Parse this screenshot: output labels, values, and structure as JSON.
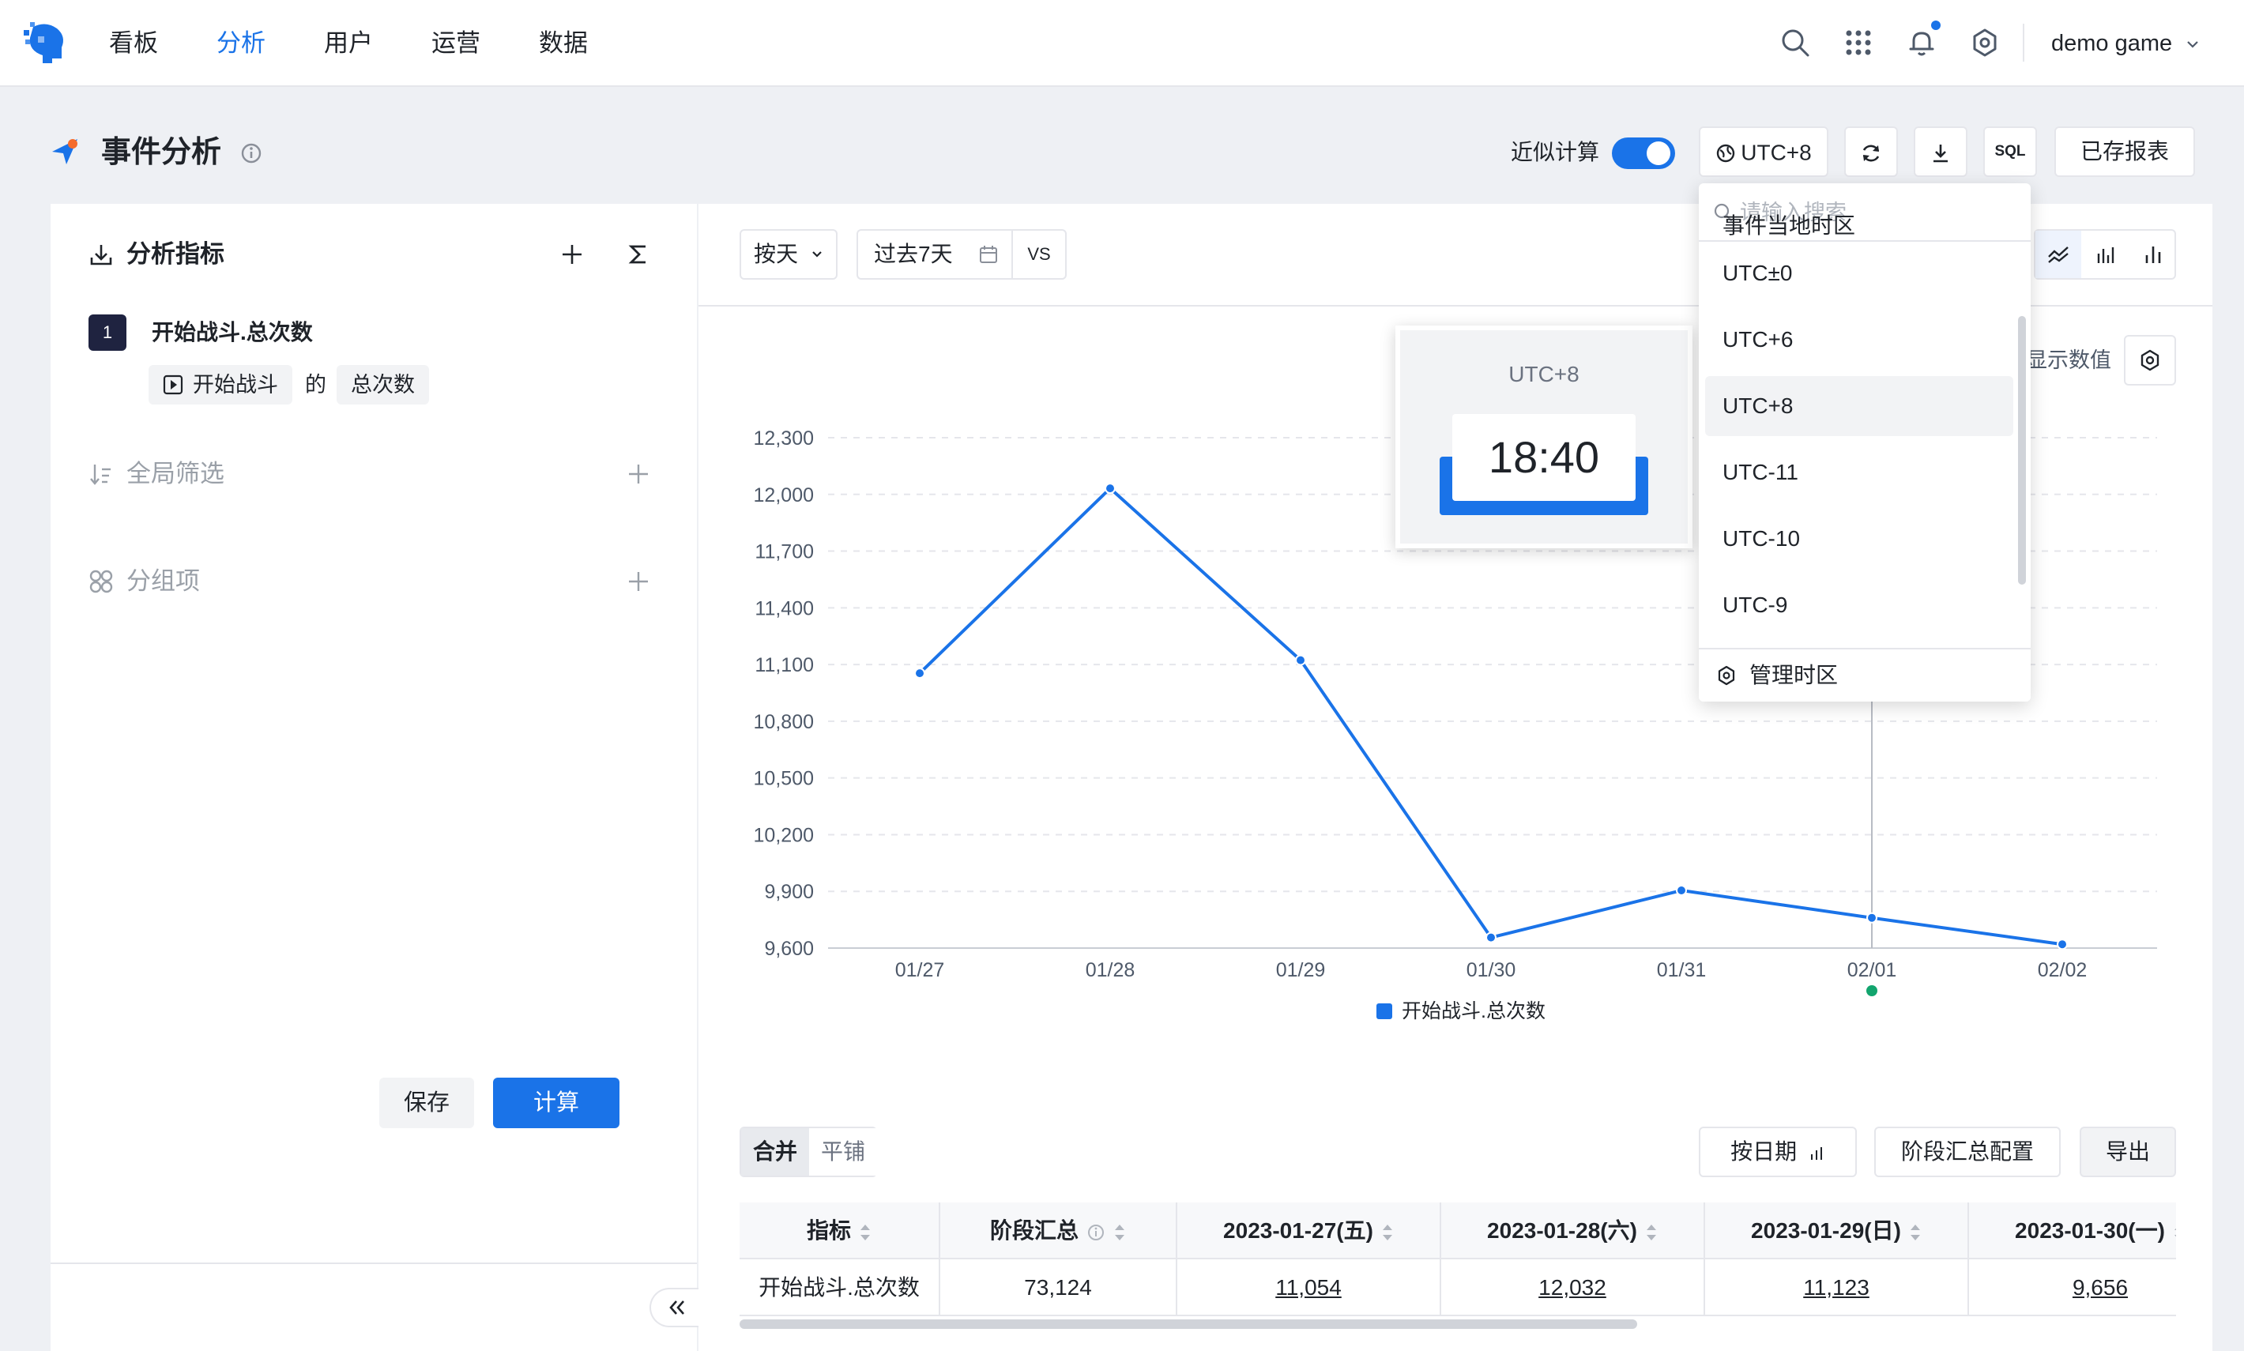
{
  "nav": {
    "items": [
      {
        "label": "看板",
        "active": false
      },
      {
        "label": "分析",
        "active": true
      },
      {
        "label": "用户",
        "active": false
      },
      {
        "label": "运营",
        "active": false
      },
      {
        "label": "数据",
        "active": false
      }
    ],
    "project": "demo game",
    "icons": [
      "search-icon",
      "apps-grid-icon",
      "bell-icon",
      "gear-icon"
    ],
    "accent": "#1a73e8"
  },
  "header": {
    "title": "事件分析",
    "approx_label": "近似计算",
    "approx_on": true,
    "timezone_label": "UTC+8",
    "sql_label": "SQL",
    "saved_reports": "已存报表"
  },
  "left": {
    "metrics_title": "分析指标",
    "metric": {
      "index": "1",
      "name": "开始战斗.总次数",
      "event": "开始战斗",
      "connector": "的",
      "measure": "总次数"
    },
    "filter_title": "全局筛选",
    "group_title": "分组项",
    "save": "保存",
    "compute": "计算"
  },
  "toolbar": {
    "granularity": "按天",
    "date_range": "过去7天",
    "vs": "VS",
    "show_values": "显示数值"
  },
  "chart_data": {
    "type": "line",
    "categories": [
      "01/27",
      "01/28",
      "01/29",
      "01/30",
      "01/31",
      "02/01",
      "02/02"
    ],
    "series": [
      {
        "name": "开始战斗.总次数",
        "values": [
          11054,
          12032,
          11123,
          9656,
          9905,
          9760,
          9620
        ],
        "color": "#1a73e8"
      }
    ],
    "yticks": [
      "12,300",
      "12,000",
      "11,700",
      "11,400",
      "11,100",
      "10,800",
      "10,500",
      "10,200",
      "9,900",
      "9,600"
    ],
    "ylim": [
      9600,
      12300
    ],
    "grid": true,
    "legend": "bottom",
    "hover_index": 5
  },
  "tooltip": {
    "timezone": "UTC+8",
    "time": "18:40"
  },
  "table": {
    "view_merge": "合并",
    "view_tile": "平铺",
    "by_date": "按日期",
    "summary_config": "阶段汇总配置",
    "export": "导出",
    "columns": [
      "指标",
      "阶段汇总",
      "2023-01-27(五)",
      "2023-01-28(六)",
      "2023-01-29(日)",
      "2023-01-30(一)"
    ],
    "rows": [
      [
        "开始战斗.总次数",
        "73,124",
        "11,054",
        "12,032",
        "11,123",
        "9,656"
      ]
    ]
  },
  "timezone_dropdown": {
    "search_placeholder": "请输入搜索",
    "partial_top": "事件当地时区",
    "options": [
      "UTC±0",
      "UTC+6",
      "UTC+8",
      "UTC-11",
      "UTC-10",
      "UTC-9"
    ],
    "selected": "UTC+8",
    "manage": "管理时区"
  }
}
